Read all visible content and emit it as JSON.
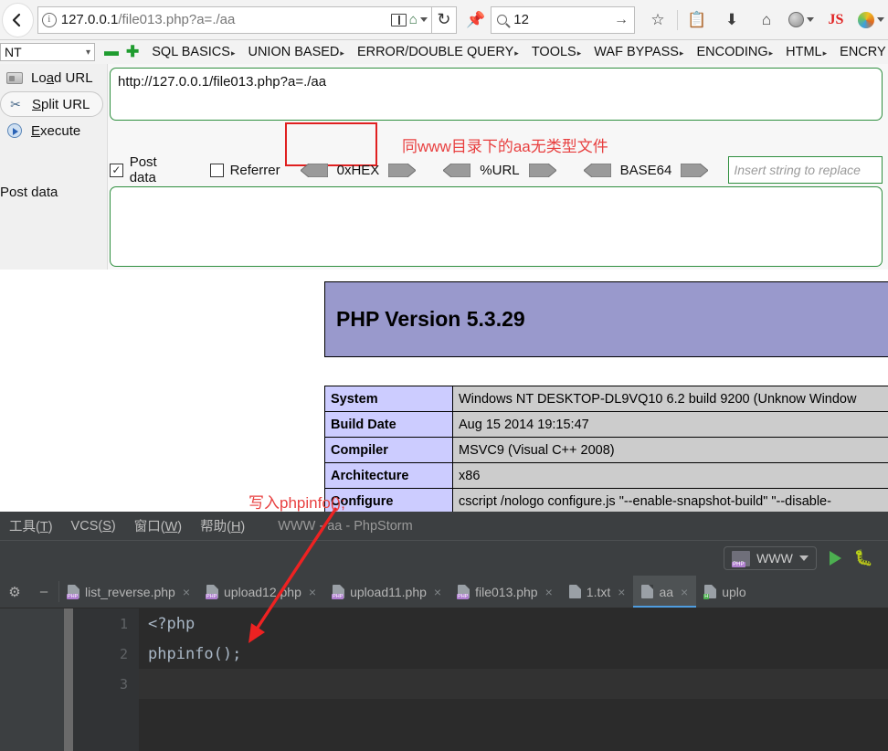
{
  "browser": {
    "back_icon": "back-arrow-icon",
    "info_icon": "page-info-icon",
    "url_prefix": "127.0.0.1",
    "url_suffix": "/file013.php?a=./aa",
    "reader_icon": "reader-view-icon",
    "home_icon": "home-icon",
    "reload_icon": "reload-icon",
    "pin_icon": "pin-icon",
    "search_value": "12",
    "search_go_icon": "arrow-right-icon",
    "toolbar_icons": [
      {
        "name": "bookmark-star-icon",
        "glyph": "☆"
      },
      {
        "name": "pocket-list-icon",
        "glyph": "☰"
      },
      {
        "name": "downloads-icon",
        "glyph": "⬇"
      },
      {
        "name": "home-icon",
        "glyph": "⌂"
      },
      {
        "name": "globe-icon",
        "glyph": ""
      },
      {
        "name": "js-toggle-icon",
        "label": "JS"
      },
      {
        "name": "firefox-addon-icon",
        "glyph": ""
      }
    ]
  },
  "hackbar": {
    "select_value": "NT",
    "minus_icon": "collapse-icon",
    "plus_icon": "expand-icon",
    "menu": [
      {
        "label": "SQL BASICS"
      },
      {
        "label": "UNION BASED"
      },
      {
        "label": "ERROR/DOUBLE QUERY"
      },
      {
        "label": "TOOLS"
      },
      {
        "label": "WAF BYPASS"
      },
      {
        "label": "ENCODING"
      },
      {
        "label": "HTML"
      },
      {
        "label": "ENCRY"
      }
    ],
    "side_buttons": [
      {
        "label_pre": "Lo",
        "label_u": "a",
        "label_post": "d URL",
        "icon": "load-url-icon"
      },
      {
        "label_pre": "",
        "label_u": "S",
        "label_post": "plit URL",
        "icon": "split-url-icon"
      },
      {
        "label_pre": "",
        "label_u": "E",
        "label_post": "xecute",
        "icon": "execute-icon"
      }
    ],
    "post_data_label": "Post data",
    "url_value": "http://127.0.0.1/file013.php?a=./aa",
    "checkbox_post_data": {
      "label": "Post data",
      "checked": true,
      "mark": "✓"
    },
    "checkbox_referrer": {
      "label": "Referrer",
      "checked": false,
      "mark": ""
    },
    "encoders": [
      "0xHEX",
      "%URL",
      "BASE64"
    ],
    "replace_placeholder": "Insert string to replace",
    "post_textarea_value": ""
  },
  "annotations": {
    "url_note": "同www目录下的aa无类型文件",
    "code_note": "写入phpinfo();",
    "highlight_color": "#e02020"
  },
  "phpinfo": {
    "version_title": "PHP Version 5.3.29",
    "banner_color": "#9999cc",
    "rows": [
      {
        "key": "System",
        "value": "Windows NT DESKTOP-DL9VQ10 6.2 build 9200 (Unknow Window"
      },
      {
        "key": "Build Date",
        "value": "Aug 15 2014 19:15:47"
      },
      {
        "key": "Compiler",
        "value": "MSVC9 (Visual C++ 2008)"
      },
      {
        "key": "Architecture",
        "value": "x86"
      },
      {
        "key": "Configure",
        "value": "cscript /nologo configure.js \"--enable-snapshot-build\" \"--disable-"
      }
    ]
  },
  "phpstorm": {
    "menu": [
      {
        "pre": "工具(",
        "u": "T",
        "post": ")"
      },
      {
        "pre": "VCS(",
        "u": "S",
        "post": ")"
      },
      {
        "pre": "窗口(",
        "u": "W",
        "post": ")"
      },
      {
        "pre": "帮助(",
        "u": "H",
        "post": ")"
      }
    ],
    "window_title": "WWW - aa - PhpStorm",
    "run_config": "WWW",
    "run_icon": "run-button-icon",
    "debug_icon": "debug-button-icon",
    "gear_icon": "settings-gear-icon",
    "minimize_icon": "minimize-icon",
    "tabs": [
      {
        "label": "list_reverse.php",
        "type": "php",
        "active": false,
        "close": "×"
      },
      {
        "label": "upload12.php",
        "type": "php",
        "active": false,
        "close": "×"
      },
      {
        "label": "upload11.php",
        "type": "php",
        "active": false,
        "close": "×"
      },
      {
        "label": "file013.php",
        "type": "php",
        "active": false,
        "close": "×"
      },
      {
        "label": "1.txt",
        "type": "txt",
        "active": false,
        "close": "×"
      },
      {
        "label": "aa",
        "type": "txt",
        "active": true,
        "close": "×"
      },
      {
        "label": "uplo",
        "type": "html",
        "active": false,
        "close": ""
      }
    ],
    "code": [
      {
        "num": "1",
        "text": "<?php",
        "current": false
      },
      {
        "num": "2",
        "text": "phpinfo();",
        "current": false
      },
      {
        "num": "3",
        "text": "",
        "current": true
      }
    ]
  }
}
